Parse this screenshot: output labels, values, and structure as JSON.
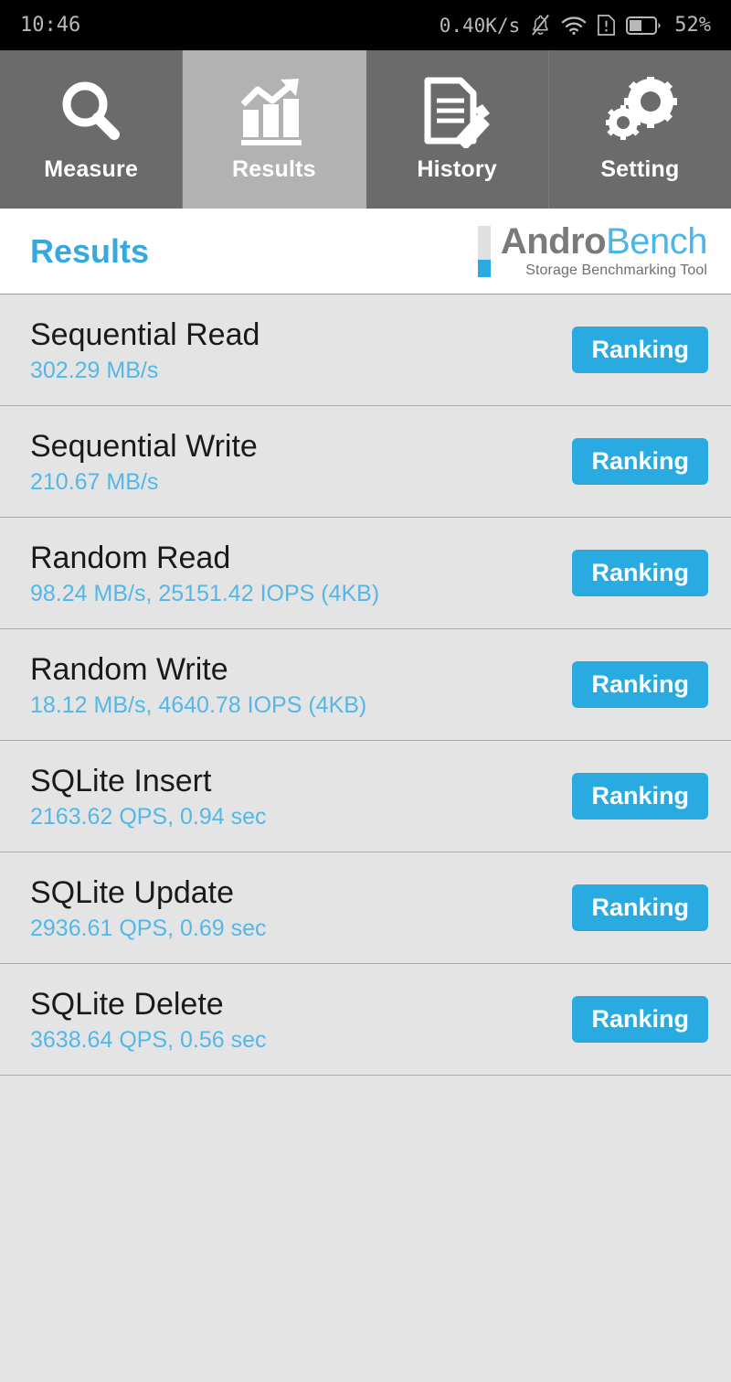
{
  "statusbar": {
    "time": "10:46",
    "network_speed": "0.40K/s",
    "battery_percent": "52%",
    "icons": [
      "bell-muted-icon",
      "wifi-icon",
      "sim-alert-icon",
      "battery-icon"
    ]
  },
  "tabs": [
    {
      "label": "Measure",
      "icon": "magnifier-icon",
      "active": false
    },
    {
      "label": "Results",
      "icon": "bar-chart-arrow-icon",
      "active": true
    },
    {
      "label": "History",
      "icon": "document-pencil-icon",
      "active": false
    },
    {
      "label": "Setting",
      "icon": "gears-icon",
      "active": false
    }
  ],
  "header": {
    "page_title": "Results",
    "logo_primary": "Andro",
    "logo_secondary": "Bench",
    "logo_tagline": "Storage Benchmarking Tool"
  },
  "results": {
    "ranking_label": "Ranking",
    "rows": [
      {
        "title": "Sequential Read",
        "value": "302.29 MB/s"
      },
      {
        "title": "Sequential Write",
        "value": "210.67 MB/s"
      },
      {
        "title": "Random Read",
        "value": "98.24 MB/s, 25151.42 IOPS (4KB)"
      },
      {
        "title": "Random Write",
        "value": "18.12 MB/s, 4640.78 IOPS (4KB)"
      },
      {
        "title": "SQLite Insert",
        "value": "2163.62 QPS, 0.94 sec"
      },
      {
        "title": "SQLite Update",
        "value": "2936.61 QPS, 0.69 sec"
      },
      {
        "title": "SQLite Delete",
        "value": "3638.64 QPS, 0.56 sec"
      }
    ]
  },
  "colors": {
    "accent_blue": "#29abe2",
    "value_blue": "#53b7e8",
    "tab_inactive": "#6b6b6b",
    "tab_active": "#b2b2b2",
    "list_bg": "#e4e4e4"
  }
}
